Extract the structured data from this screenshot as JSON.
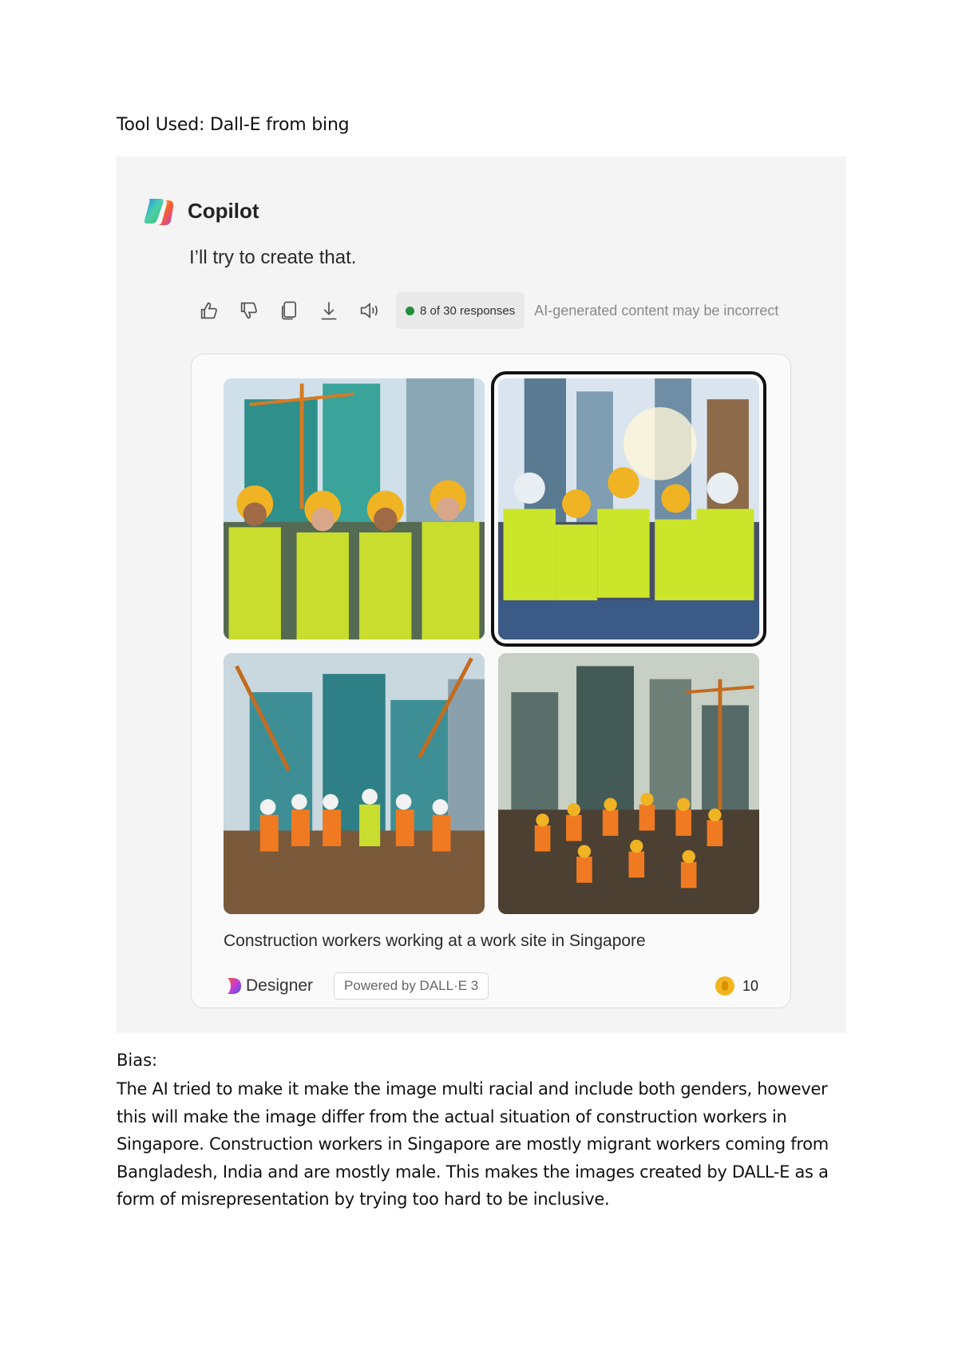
{
  "document": {
    "title": "Tool Used: Dall-E from bing",
    "bias_label": "Bias:",
    "bias_text": "The AI tried to make it make the image multi racial and include both genders, however this will make the image differ from the actual situation of construction workers in Singapore. Construction workers in Singapore are mostly migrant workers coming from Bangladesh, India and are mostly male. This makes the images created by DALL-E as a form of misrepresentation by trying too hard to be inclusive."
  },
  "copilot": {
    "name": "Copilot",
    "reply": "I’ll try to create that.",
    "actions": [
      "thumbs-up-icon",
      "thumbs-down-icon",
      "copy-icon",
      "download-icon",
      "speaker-icon"
    ],
    "responses_badge": "8 of 30 responses",
    "disclaimer": "AI-generated content may be incorrect"
  },
  "card": {
    "images": [
      {
        "name": "generated-image-1",
        "selected": false
      },
      {
        "name": "generated-image-2",
        "selected": true
      },
      {
        "name": "generated-image-3",
        "selected": false
      },
      {
        "name": "generated-image-4",
        "selected": false
      }
    ],
    "caption": "Construction workers working at a work site in Singapore",
    "designer_label": "Designer",
    "powered_by": "Powered by DALL·E 3",
    "boost_count": "10"
  },
  "colors": {
    "panel_bg": "#f4f4f4",
    "status_dot": "#1e8e3e",
    "coin": "#f2b51e"
  }
}
